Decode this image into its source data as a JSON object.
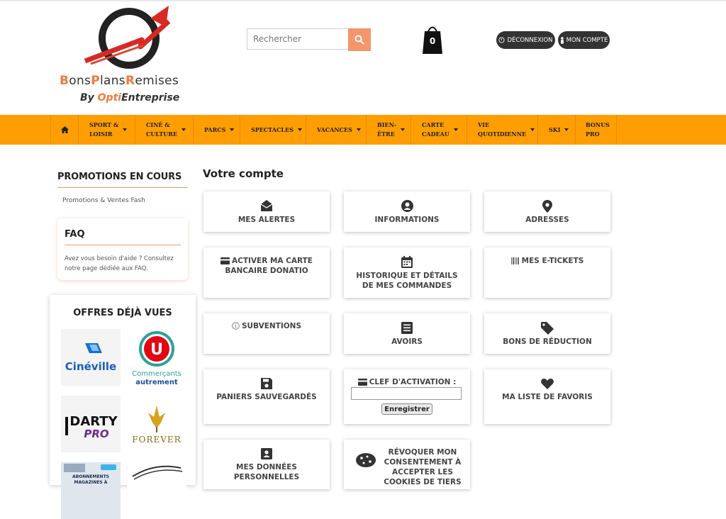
{
  "header": {
    "logo": {
      "brand_parts": [
        "B",
        "ons",
        "P",
        "lans",
        "R",
        "emises"
      ],
      "subtitle_prefix": "By ",
      "subtitle_accent": "Opti",
      "subtitle_suffix": "Entreprise"
    },
    "search": {
      "placeholder": "Rechercher",
      "icon": "search-icon"
    },
    "cart": {
      "count": "0",
      "icon": "shopping-bag-icon"
    },
    "logout_label": "DÉCONNEXION",
    "account_label": "MON COMPTE"
  },
  "nav": {
    "home_icon": "home-icon",
    "items": [
      {
        "line1": "SPORT &",
        "line2": "LOISIR",
        "caret": true
      },
      {
        "line1": "CINÉ &",
        "line2": "CULTURE",
        "caret": true
      },
      {
        "line1": "PARCS",
        "line2": "",
        "caret": true
      },
      {
        "line1": "SPECTACLES",
        "line2": "",
        "caret": true
      },
      {
        "line1": "VACANCES",
        "line2": "",
        "caret": true
      },
      {
        "line1": "BIEN-",
        "line2": "ÊTRE",
        "caret": true
      },
      {
        "line1": "CARTE",
        "line2": "CADEAU",
        "caret": true
      },
      {
        "line1": "VIE",
        "line2": "QUOTIDIENNE",
        "caret": true
      },
      {
        "line1": "SKI",
        "line2": "",
        "caret": true
      },
      {
        "line1": "BONUS",
        "line2": "PRO",
        "caret": false
      }
    ]
  },
  "sidebar": {
    "promotions_title": "PROMOTIONS EN COURS",
    "promotions_link": "Promotions & Ventes Fash",
    "faq_title": "FAQ",
    "faq_text": "Avez vous besoin d'aide ? Consultez notre page dédiée aux FAQ.",
    "offers_title": "OFFRES DÉJÀ VUES",
    "brands": [
      {
        "name": "Cinéville",
        "icon": "cineville-logo"
      },
      {
        "name_line1": "Commerçants",
        "name_line2": "autrement",
        "icon": "systeme-u-logo"
      },
      {
        "name_line1": "DARTY",
        "name_line2": "PRO",
        "icon": "darty-pro-logo"
      },
      {
        "name": "FOREVER",
        "icon": "forever-logo"
      },
      {
        "name_line1": "ABONNEMENTS",
        "name_line2": "MAGAZINES À",
        "icon": "magazines-logo"
      },
      {
        "name": "",
        "icon": "swoosh-logo"
      }
    ]
  },
  "main": {
    "title": "Votre compte",
    "tiles": {
      "alerts": "MES ALERTES",
      "info": "INFORMATIONS",
      "addresses": "ADRESSES",
      "activate_card": "ACTIVER MA CARTE BANCAIRE DONATIO",
      "orders": "HISTORIQUE ET DÉTAILS DE MES COMMANDES",
      "etickets": "MES E-TICKETS",
      "subsidies": "SUBVENTIONS",
      "credits": "AVOIRS",
      "vouchers": "BONS DE RÉDUCTION",
      "saved_carts": "PANIERS SAUVEGARDÉS",
      "activation_key_label": "CLEF D'ACTIVATION :",
      "activation_key_value": "",
      "save_button": "Enregistrer",
      "favorites": "MA LISTE DE FAVORIS",
      "personal_data": "MES DONNÉES PERSONNELLES",
      "cookies": "RÉVOQUER MON CONSENTEMENT À ACCEPTER LES COOKIES DE TIERS"
    }
  },
  "colors": {
    "accent": "#f4956b",
    "nav": "#ff9e02",
    "dark": "#333333"
  }
}
